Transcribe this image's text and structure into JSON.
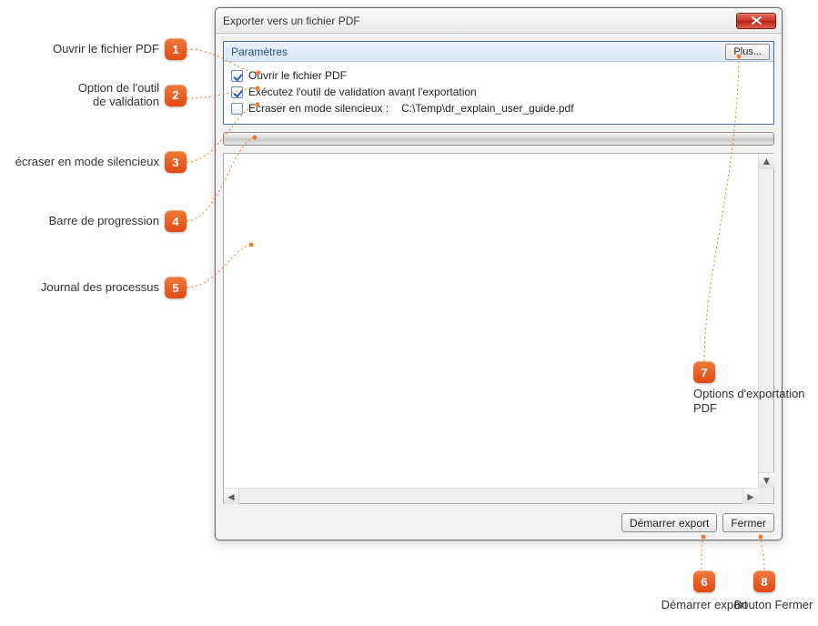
{
  "dialog": {
    "title": "Exporter vers un fichier PDF"
  },
  "params": {
    "header_label": "Paramètres",
    "more_button": "Plus...",
    "open_pdf_label": "Ouvrir le fichier PDF",
    "validate_label": "Exécutez l'outil de validation avant l'exportation",
    "overwrite_label": "Ecraser en mode silencieux :",
    "overwrite_path": "C:\\Temp\\dr_explain_user_guide.pdf"
  },
  "buttons": {
    "start": "Démarrer export",
    "close": "Fermer"
  },
  "callouts": {
    "c1": "Ouvrir le fichier PDF",
    "c2_line1": "Option de l'outil",
    "c2_line2": "de validation",
    "c3": "écraser en mode silencieux",
    "c4": "Barre de progression",
    "c5": "Journal des processus",
    "c6": "Démarrer export",
    "c7": "Options d'exportation PDF",
    "c8": "Bouton Fermer"
  },
  "markers": {
    "m1": "1",
    "m2": "2",
    "m3": "3",
    "m4": "4",
    "m5": "5",
    "m6": "6",
    "m7": "7",
    "m8": "8"
  }
}
